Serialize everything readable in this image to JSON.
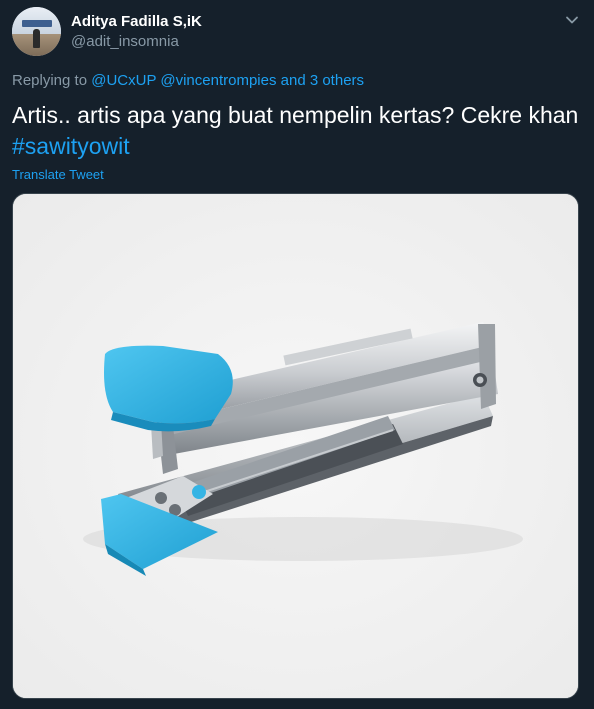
{
  "author": {
    "display_name": "Aditya Fadilla S,iK",
    "handle": "@adit_insomnia"
  },
  "reply": {
    "prefix": "Replying to",
    "mention_1": "@UCxUP",
    "mention_2": "@vincentrompies",
    "others": "and 3 others"
  },
  "tweet": {
    "text": "Artis.. artis apa yang buat nempelin kertas? Cekre khan",
    "hashtag": "#sawityowit",
    "translate_label": "Translate Tweet"
  },
  "media": {
    "subject": "stapler"
  },
  "icons": {
    "menu": "chevron-down-icon"
  },
  "colors": {
    "background": "#15202b",
    "link": "#1da1f2",
    "secondary_text": "#8899a6",
    "stapler_accent": "#35b4e4"
  }
}
